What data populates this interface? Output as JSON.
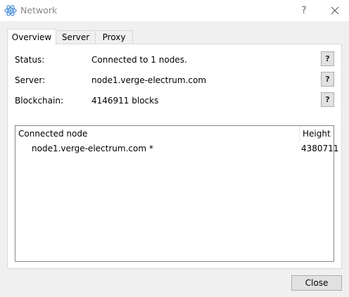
{
  "window": {
    "title": "Network",
    "help_glyph": "?",
    "icons": {
      "app": "electrum-logo-icon",
      "close": "close-icon"
    }
  },
  "tabs": [
    {
      "label": "Overview",
      "active": true
    },
    {
      "label": "Server",
      "active": false
    },
    {
      "label": "Proxy",
      "active": false
    }
  ],
  "overview": {
    "rows": [
      {
        "label": "Status:",
        "value": "Connected to 1 nodes.",
        "help": "?"
      },
      {
        "label": "Server:",
        "value": "node1.verge-electrum.com",
        "help": "?"
      },
      {
        "label": "Blockchain:",
        "value": "4146911 blocks",
        "help": "?"
      }
    ],
    "table": {
      "headers": {
        "node": "Connected node",
        "height": "Height"
      },
      "rows": [
        {
          "node": "node1.verge-electrum.com *",
          "height": "4380711"
        }
      ]
    }
  },
  "footer": {
    "close_label": "Close"
  },
  "colors": {
    "accent": "#4a90d9"
  }
}
